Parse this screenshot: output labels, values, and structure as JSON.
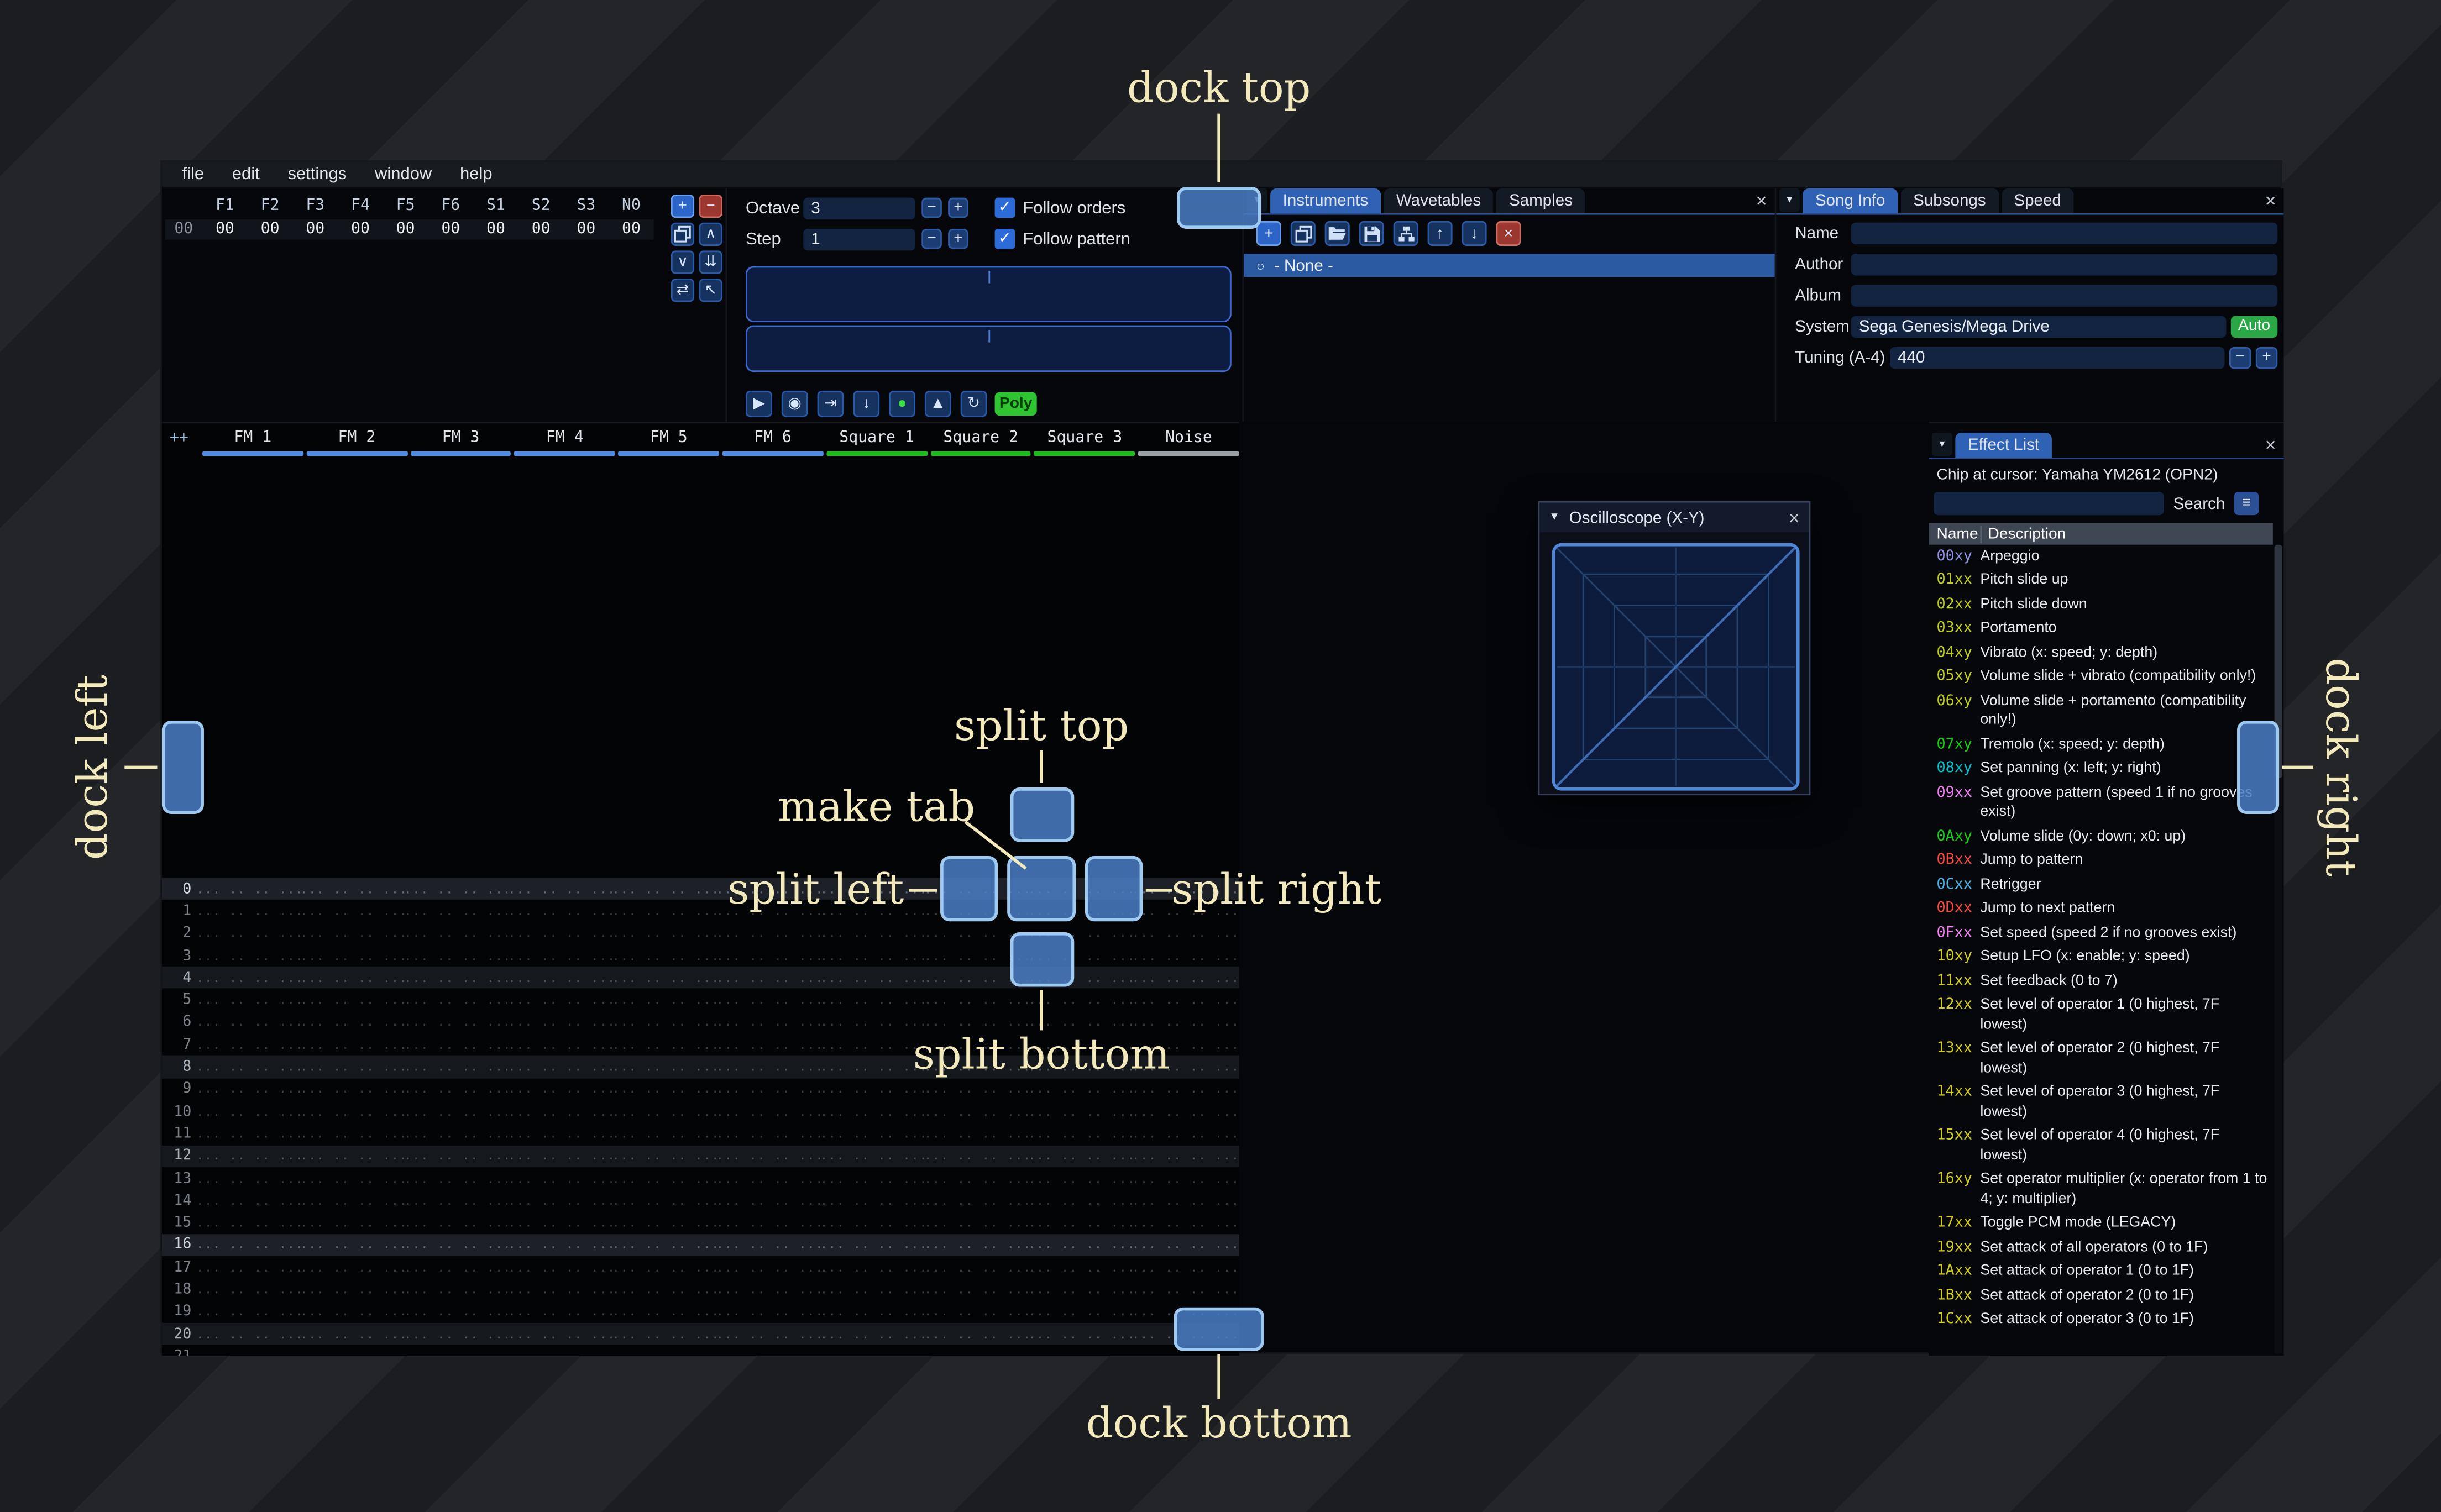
{
  "window": {
    "menu_items": [
      "file",
      "edit",
      "settings",
      "window",
      "help"
    ]
  },
  "icons": {
    "plus": "+",
    "minus": "−",
    "up_caret": "∧",
    "down_caret": "∨",
    "double_down": "⇊",
    "swap": "⇄",
    "pointer": "↖",
    "arrow_up": "↑",
    "arrow_down": "↓",
    "close": "×",
    "check": "✓",
    "collapse": "▼",
    "hamburger": "≡",
    "play": "▶",
    "stop": "◉",
    "play_row": "⇥",
    "step_row": "↓",
    "edit": "●",
    "metronome": "▲",
    "repeat": "↻",
    "instrument_circle": "○"
  },
  "orders": {
    "columns": [
      "F1",
      "F2",
      "F3",
      "F4",
      "F5",
      "F6",
      "S1",
      "S2",
      "S3",
      "N0"
    ],
    "row_index": "00",
    "row_values": [
      "00",
      "00",
      "00",
      "00",
      "00",
      "00",
      "00",
      "00",
      "00",
      "00"
    ],
    "toolbar": [
      {
        "name": "add-order-button",
        "icon": "plus",
        "kind": "blue"
      },
      {
        "name": "remove-order-button",
        "icon": "minus",
        "kind": "red"
      },
      {
        "name": "duplicate-order-button",
        "icon": "duplicate",
        "kind": ""
      },
      {
        "name": "order-up-button",
        "icon": "up_caret",
        "kind": ""
      },
      {
        "name": "order-down-button",
        "icon": "down_caret",
        "kind": ""
      },
      {
        "name": "order-deep-clone-button",
        "icon": "double_down",
        "kind": ""
      },
      {
        "name": "order-change-mode-button",
        "icon": "swap",
        "kind": ""
      },
      {
        "name": "order-edit-button",
        "icon": "pointer",
        "kind": ""
      }
    ]
  },
  "controls": {
    "octave_label": "Octave",
    "octave_value": "3",
    "step_label": "Step",
    "step_value": "1",
    "follow_orders_label": "Follow orders",
    "follow_pattern_label": "Follow pattern",
    "poly_label": "Poly",
    "transport": [
      {
        "name": "play-button",
        "icon": "play",
        "kind": ""
      },
      {
        "name": "stop-button",
        "icon": "stop",
        "kind": ""
      },
      {
        "name": "play-row-button",
        "icon": "play_row",
        "kind": ""
      },
      {
        "name": "step-row-button",
        "icon": "step_row",
        "kind": ""
      },
      {
        "name": "edit-toggle-button",
        "icon": "edit",
        "kind": "green-glyph"
      },
      {
        "name": "metronome-button",
        "icon": "metronome",
        "kind": ""
      },
      {
        "name": "repeat-button",
        "icon": "repeat",
        "kind": ""
      }
    ]
  },
  "instruments": {
    "tabs": [
      "Instruments",
      "Wavetables",
      "Samples"
    ],
    "active_tab": "Instruments",
    "toolbar": [
      {
        "name": "add-instrument-button",
        "icon": "plus",
        "kind": "blue"
      },
      {
        "name": "duplicate-instrument-button",
        "icon": "duplicate",
        "kind": ""
      },
      {
        "name": "open-instrument-button",
        "icon": "folder_open",
        "kind": ""
      },
      {
        "name": "save-instrument-button",
        "icon": "save",
        "kind": ""
      },
      {
        "name": "instrument-folders-button",
        "icon": "tree",
        "kind": ""
      },
      {
        "name": "instrument-up-button",
        "icon": "arrow_up",
        "kind": ""
      },
      {
        "name": "instrument-down-button",
        "icon": "arrow_down",
        "kind": ""
      },
      {
        "name": "delete-instrument-button",
        "icon": "close",
        "kind": "red"
      }
    ],
    "list": [
      {
        "label": "- None -",
        "selected": true
      }
    ]
  },
  "song_info": {
    "tabs": [
      "Song Info",
      "Subsongs",
      "Speed"
    ],
    "active_tab": "Song Info",
    "auto_label": "Auto",
    "fields": [
      {
        "label": "Name",
        "value": "",
        "trail": ""
      },
      {
        "label": "Author",
        "value": "",
        "trail": ""
      },
      {
        "label": "Album",
        "value": "",
        "trail": ""
      },
      {
        "label": "System",
        "value": "Sega Genesis/Mega Drive",
        "trail": "auto"
      },
      {
        "label": "Tuning (A-4)",
        "value": "440",
        "trail": "stepper"
      }
    ]
  },
  "pattern": {
    "corner_label": "++",
    "visible_rows": 22,
    "empty_cell": "... .. .. ...",
    "channels": [
      {
        "name": "FM 1",
        "color": "#4f8be8"
      },
      {
        "name": "FM 2",
        "color": "#4f8be8"
      },
      {
        "name": "FM 3",
        "color": "#4f8be8"
      },
      {
        "name": "FM 4",
        "color": "#4f8be8"
      },
      {
        "name": "FM 5",
        "color": "#4f8be8"
      },
      {
        "name": "FM 6",
        "color": "#4f8be8"
      },
      {
        "name": "Square 1",
        "color": "#18c018"
      },
      {
        "name": "Square 2",
        "color": "#18c018"
      },
      {
        "name": "Square 3",
        "color": "#18c018"
      },
      {
        "name": "Noise",
        "color": "#9aa0a6"
      }
    ]
  },
  "oscilloscope": {
    "title": "Oscilloscope (X-Y)"
  },
  "effect_list": {
    "tab_label": "Effect List",
    "chip_line": "Chip at cursor: Yamaha YM2612 (OPN2)",
    "search_label": "Search",
    "search_value": "",
    "name_header": "Name",
    "desc_header": "Description",
    "rows": [
      {
        "code": "00xy",
        "color": "#9496e2",
        "desc": "Arpeggio"
      },
      {
        "code": "01xx",
        "color": "#c3cf1b",
        "desc": "Pitch slide up"
      },
      {
        "code": "02xx",
        "color": "#c3cf1b",
        "desc": "Pitch slide down"
      },
      {
        "code": "03xx",
        "color": "#c3cf1b",
        "desc": "Portamento"
      },
      {
        "code": "04xy",
        "color": "#c3cf1b",
        "desc": "Vibrato (x: speed; y: depth)"
      },
      {
        "code": "05xy",
        "color": "#c3cf1b",
        "desc": "Volume slide + vibrato (compatibility only!)"
      },
      {
        "code": "06xy",
        "color": "#c3cf1b",
        "desc": "Volume slide + portamento (compatibility only!)"
      },
      {
        "code": "07xy",
        "color": "#15d015",
        "desc": "Tremolo (x: speed; y: depth)"
      },
      {
        "code": "08xy",
        "color": "#00c5cf",
        "desc": "Set panning (x: left; y: right)"
      },
      {
        "code": "09xx",
        "color": "#f580f5",
        "desc": "Set groove pattern (speed 1 if no grooves exist)"
      },
      {
        "code": "0Axy",
        "color": "#15d015",
        "desc": "Volume slide (0y: down; x0: up)"
      },
      {
        "code": "0Bxx",
        "color": "#fb4a3f",
        "desc": "Jump to pattern"
      },
      {
        "code": "0Cxx",
        "color": "#46b7e8",
        "desc": "Retrigger"
      },
      {
        "code": "0Dxx",
        "color": "#fb4a3f",
        "desc": "Jump to next pattern"
      },
      {
        "code": "0Fxx",
        "color": "#f580f5",
        "desc": "Set speed (speed 2 if no grooves exist)"
      },
      {
        "code": "10xy",
        "color": "#d3ce1e",
        "desc": "Setup LFO (x: enable; y: speed)"
      },
      {
        "code": "11xx",
        "color": "#d3ce1e",
        "desc": "Set feedback (0 to 7)"
      },
      {
        "code": "12xx",
        "color": "#d3ce1e",
        "desc": "Set level of operator 1 (0 highest, 7F lowest)"
      },
      {
        "code": "13xx",
        "color": "#d3ce1e",
        "desc": "Set level of operator 2 (0 highest, 7F lowest)"
      },
      {
        "code": "14xx",
        "color": "#d3ce1e",
        "desc": "Set level of operator 3 (0 highest, 7F lowest)"
      },
      {
        "code": "15xx",
        "color": "#d3ce1e",
        "desc": "Set level of operator 4 (0 highest, 7F lowest)"
      },
      {
        "code": "16xy",
        "color": "#d3ce1e",
        "desc": "Set operator multiplier (x: operator from 1 to 4; y: multiplier)"
      },
      {
        "code": "17xx",
        "color": "#d3ce1e",
        "desc": "Toggle PCM mode (LEGACY)"
      },
      {
        "code": "19xx",
        "color": "#d3ce1e",
        "desc": "Set attack of all operators (0 to 1F)"
      },
      {
        "code": "1Axx",
        "color": "#d3ce1e",
        "desc": "Set attack of operator 1 (0 to 1F)"
      },
      {
        "code": "1Bxx",
        "color": "#d3ce1e",
        "desc": "Set attack of operator 2 (0 to 1F)"
      },
      {
        "code": "1Cxx",
        "color": "#d3ce1e",
        "desc": "Set attack of operator 3 (0 to 1F)"
      }
    ]
  },
  "overlay": {
    "dock_top": "dock top",
    "dock_bottom": "dock bottom",
    "dock_left": "dock left",
    "dock_right": "dock right",
    "split_top": "split top",
    "split_bottom": "split bottom",
    "split_left": "split left",
    "split_right": "split right",
    "make_tab": "make tab",
    "annotation_color": "#f2eaba",
    "dock_fill": "rgba(74,126,198,0.85)",
    "dock_border": "#9ecaf2"
  }
}
